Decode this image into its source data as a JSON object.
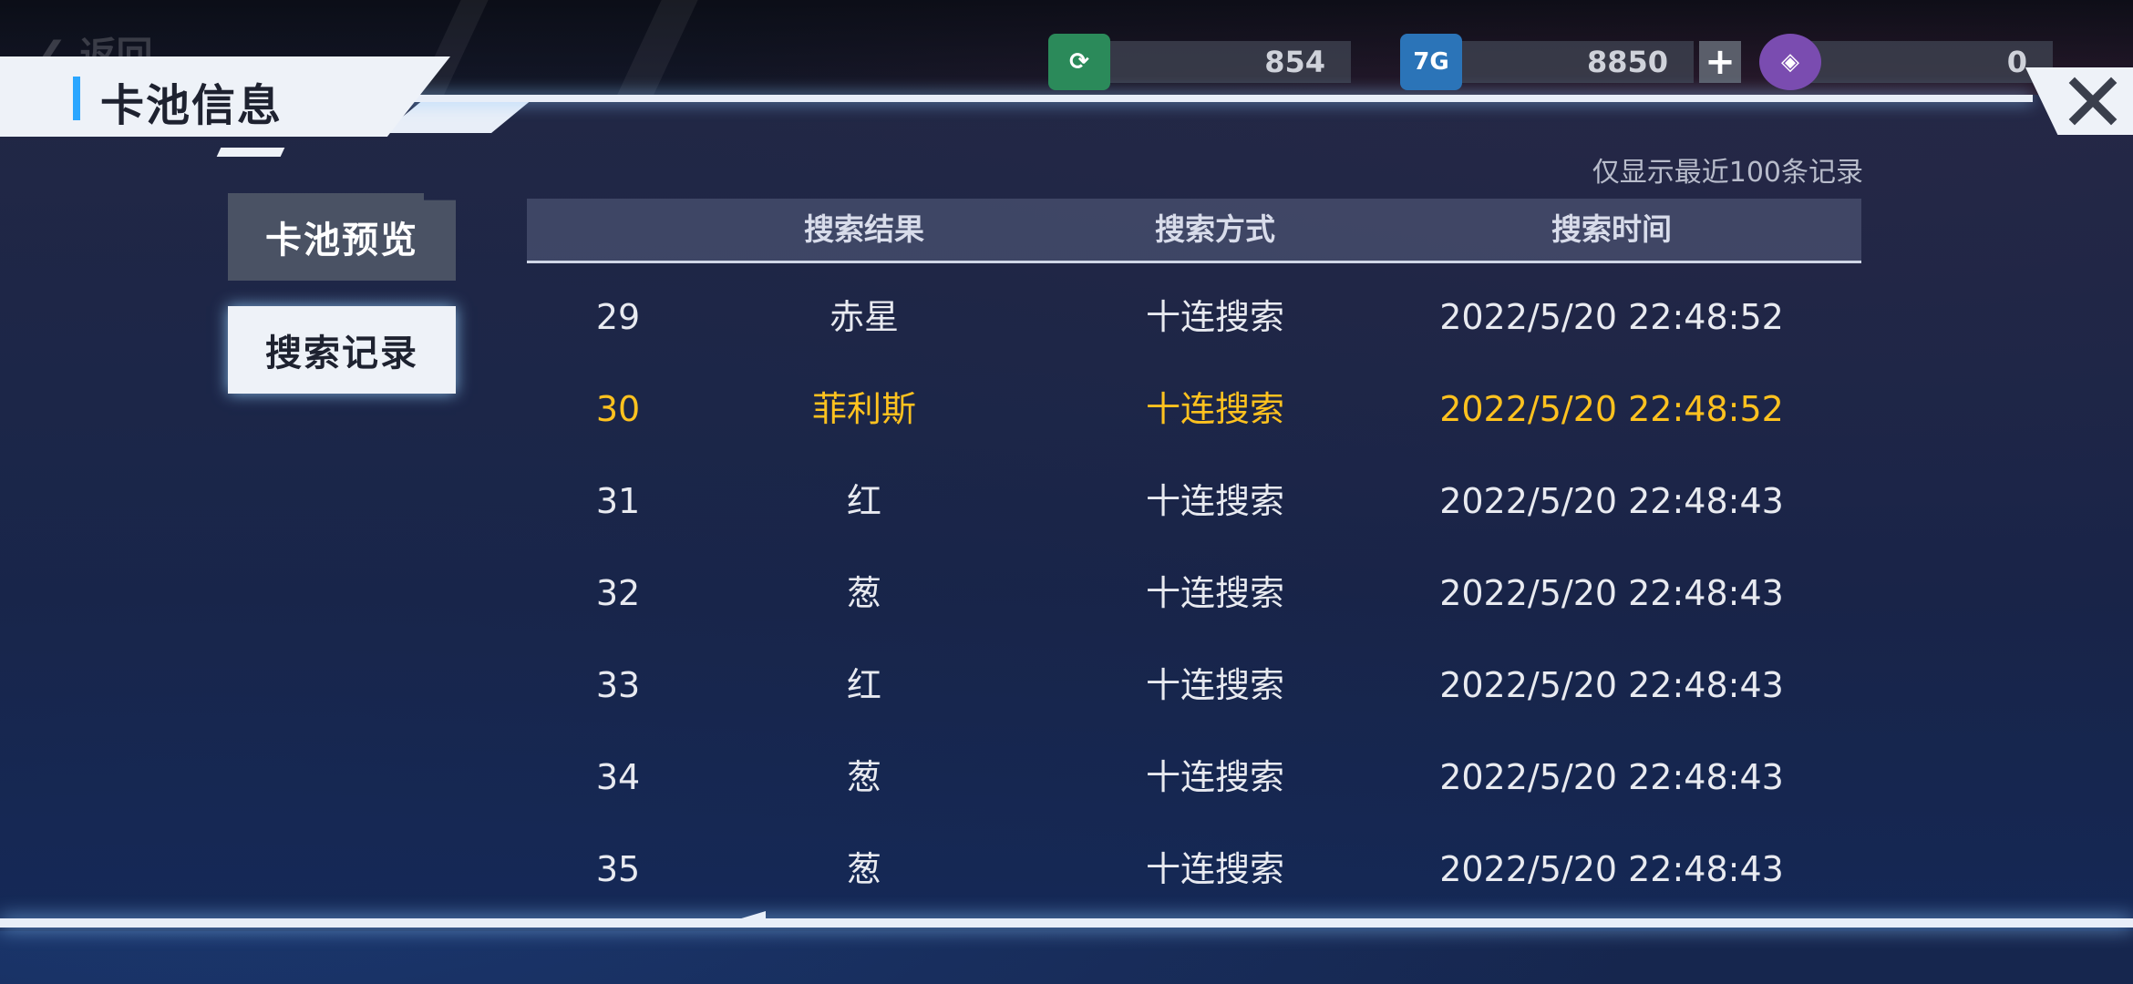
{
  "header": {
    "back_label": "返回",
    "title": "卡池信息"
  },
  "currencies": [
    {
      "icon": "green-ticket-icon",
      "value": "854",
      "has_plus": false
    },
    {
      "icon": "blue-7g-card-icon",
      "value": "8850",
      "has_plus": true
    },
    {
      "icon": "purple-crystal-icon",
      "value": "0",
      "has_plus": true
    }
  ],
  "side_tabs": [
    {
      "label": "卡池预览",
      "active": false
    },
    {
      "label": "搜索记录",
      "active": true
    }
  ],
  "records": {
    "note": "仅显示最近100条记录",
    "columns": [
      "",
      "搜索结果",
      "搜索方式",
      "搜索时间"
    ],
    "rows": [
      {
        "index": "29",
        "result": "赤星",
        "method": "十连搜索",
        "time": "2022/5/20  22:48:52",
        "highlight": false
      },
      {
        "index": "30",
        "result": "菲利斯",
        "method": "十连搜索",
        "time": "2022/5/20  22:48:52",
        "highlight": true
      },
      {
        "index": "31",
        "result": "红",
        "method": "十连搜索",
        "time": "2022/5/20  22:48:43",
        "highlight": false
      },
      {
        "index": "32",
        "result": "葱",
        "method": "十连搜索",
        "time": "2022/5/20  22:48:43",
        "highlight": false
      },
      {
        "index": "33",
        "result": "红",
        "method": "十连搜索",
        "time": "2022/5/20  22:48:43",
        "highlight": false
      },
      {
        "index": "34",
        "result": "葱",
        "method": "十连搜索",
        "time": "2022/5/20  22:48:43",
        "highlight": false
      },
      {
        "index": "35",
        "result": "葱",
        "method": "十连搜索",
        "time": "2022/5/20  22:48:43",
        "highlight": false
      }
    ]
  },
  "colors": {
    "highlight": "#ffc21f",
    "accent": "#2aa6ff"
  }
}
